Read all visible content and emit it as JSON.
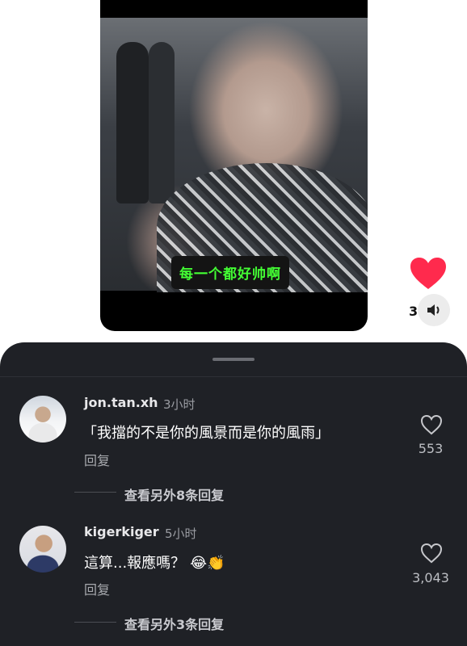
{
  "video": {
    "subtitle": "每一个都好帅啊"
  },
  "actions": {
    "sound_count": "3",
    "like_heart_color": "#ff2a4d"
  },
  "comments": [
    {
      "username": "jon.tan.xh",
      "time": "3小时",
      "text": "「我擋的不是你的風景而是你的風雨」",
      "reply_label": "回复",
      "likes": "553",
      "view_more": "查看另外8条回复"
    },
    {
      "username": "kigerkiger",
      "time": "5小时",
      "text": "這算...報應嗎？",
      "emojis": "😂👏",
      "reply_label": "回复",
      "likes": "3,043",
      "view_more": "查看另外3条回复"
    }
  ]
}
